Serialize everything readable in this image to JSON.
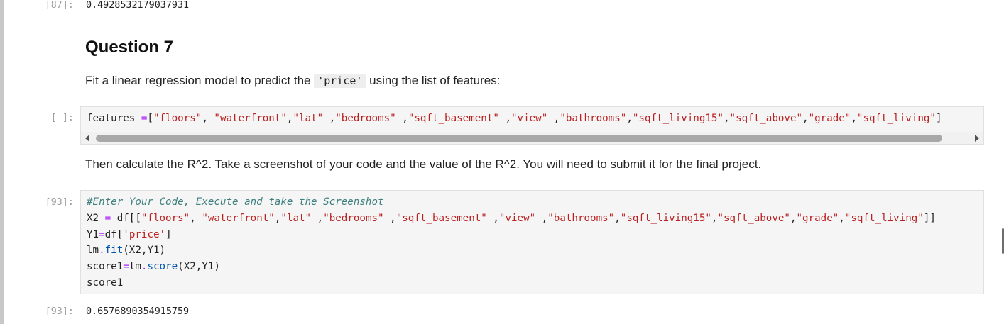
{
  "cells": {
    "out87": {
      "prompt": "[87]:",
      "value": "0.4928532179037931"
    },
    "question": {
      "heading": "Question 7",
      "text_before": "Fit a linear regression model to predict the ",
      "code": "'price'",
      "text_after": " using the list of features:"
    },
    "features_cell": {
      "prompt": "[ ]:",
      "l1": {
        "a": "features ",
        "b": "=",
        "c": "[",
        "d": "\"floors\"",
        "e": ", ",
        "f": "\"waterfront\"",
        "g": ",",
        "h": "\"lat\"",
        "i": " ,",
        "j": "\"bedrooms\"",
        "k": " ,",
        "l": "\"sqft_basement\"",
        "m": " ,",
        "n": "\"view\"",
        "o": " ,",
        "p": "\"bathrooms\"",
        "q": ",",
        "r": "\"sqft_living15\"",
        "s": ",",
        "t": "\"sqft_above\"",
        "u": ",",
        "v": "\"grade\"",
        "w": ",",
        "x": "\"sqft_living\"",
        "y": "]"
      }
    },
    "instruction": {
      "text": "Then calculate the R^2. Take a screenshot of your code and the value of the R^2. You will need to submit it for the final project."
    },
    "code93": {
      "prompt": "[93]:",
      "comment": "#Enter Your Code, Execute and take the Screenshot",
      "l2": {
        "a": "X2 ",
        "b": "=",
        "c": " df",
        "d": "[[",
        "e": "\"floors\"",
        "f": ", ",
        "g": "\"waterfront\"",
        "h": ",",
        "i": "\"lat\"",
        "j": " ,",
        "k": "\"bedrooms\"",
        "l": " ,",
        "m": "\"sqft_basement\"",
        "n": " ,",
        "o": "\"view\"",
        "p": " ,",
        "q": "\"bathrooms\"",
        "r": ",",
        "s": "\"sqft_living15\"",
        "t": ",",
        "u": "\"sqft_above\"",
        "v": ",",
        "w": "\"grade\"",
        "x": ",",
        "y": "\"sqft_living\"",
        "z": "]]"
      },
      "l3": {
        "a": "Y1",
        "b": "=",
        "c": "df",
        "d": "[",
        "e": "'price'",
        "f": "]"
      },
      "l4": {
        "a": "lm",
        "b": ".",
        "c": "fit",
        "d": "(X2,Y1)"
      },
      "l5": {
        "a": "score1",
        "b": "=",
        "c": "lm",
        "d": ".",
        "e": "score",
        "f": "(X2,Y1)"
      },
      "l6": {
        "a": "score1"
      }
    },
    "out93": {
      "prompt": "[93]:",
      "value": "0.6576890354915759"
    }
  }
}
